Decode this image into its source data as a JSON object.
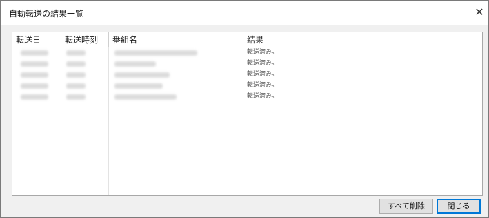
{
  "window": {
    "title": "自動転送の結果一覧",
    "close_glyph": "✕"
  },
  "table": {
    "columns": [
      "転送日",
      "転送時刻",
      "番組名",
      "結果"
    ],
    "rows": [
      {
        "date": "",
        "time": "",
        "program": "",
        "result": "転送済み。"
      },
      {
        "date": "",
        "time": "",
        "program": "",
        "result": "転送済み。"
      },
      {
        "date": "",
        "time": "",
        "program": "",
        "result": "転送済み。"
      },
      {
        "date": "",
        "time": "",
        "program": "",
        "result": "転送済み。"
      },
      {
        "date": "",
        "time": "",
        "program": "",
        "result": "転送済み。"
      }
    ],
    "empty_rows": 11
  },
  "buttons": {
    "delete_all": "すべて削除",
    "close": "閉じる"
  }
}
